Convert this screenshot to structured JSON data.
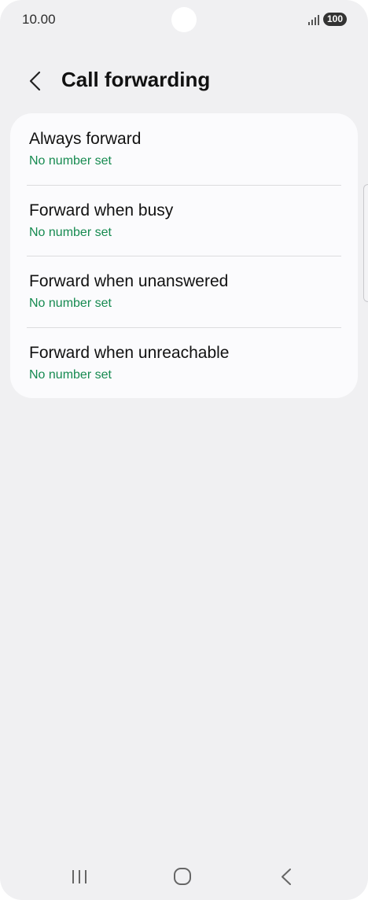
{
  "status_bar": {
    "time": "10.00",
    "battery": "100",
    "signal_icon": "signal-icon"
  },
  "header": {
    "title": "Call forwarding",
    "back_icon": "chevron-left-icon"
  },
  "options": [
    {
      "title": "Always forward",
      "subtitle": "No number set"
    },
    {
      "title": "Forward when busy",
      "subtitle": "No number set"
    },
    {
      "title": "Forward when unanswered",
      "subtitle": "No number set"
    },
    {
      "title": "Forward when unreachable",
      "subtitle": "No number set"
    }
  ],
  "nav_bar": {
    "recents_icon": "recents-icon",
    "home_icon": "home-icon",
    "back_icon": "back-icon"
  },
  "colors": {
    "background": "#f0f0f2",
    "card": "#fbfbfd",
    "subtitle_green": "#168a50",
    "text": "#111111"
  }
}
